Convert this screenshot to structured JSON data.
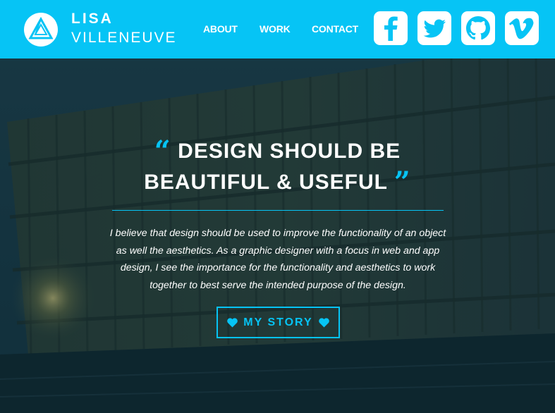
{
  "brand": {
    "first_name": "LISA",
    "last_name": "VILLENEUVE",
    "logo_icon": "triangle-logo-icon"
  },
  "nav": {
    "links": [
      "ABOUT",
      "WORK",
      "CONTACT"
    ]
  },
  "social": [
    {
      "name": "facebook",
      "icon": "facebook-icon"
    },
    {
      "name": "twitter",
      "icon": "twitter-icon"
    },
    {
      "name": "github",
      "icon": "github-icon"
    },
    {
      "name": "vimeo",
      "icon": "vimeo-icon"
    }
  ],
  "hero": {
    "headline_line1": "DESIGN SHOULD BE",
    "headline_line2": "BEAUTIFUL & USEFUL",
    "open_quote": "“",
    "close_quote": "”",
    "intro": "I believe that design should be used to improve the functionality of an object as well the aesthetics. As a graphic designer with a focus in web and app design, I see the importance for the functionality and aesthetics to work together to best serve the intended purpose of the design.",
    "cta_label": "MY STORY",
    "cta_icon": "heart-icon"
  },
  "colors": {
    "accent": "#06c4f5",
    "text": "#ffffff",
    "hero_dark": "#0d2a33"
  }
}
